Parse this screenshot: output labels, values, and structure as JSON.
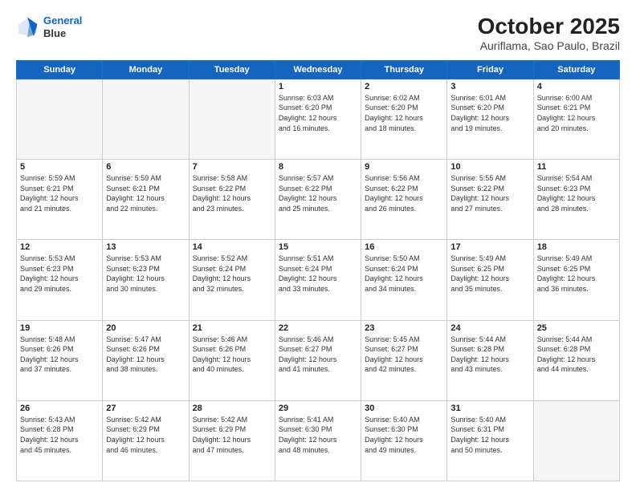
{
  "header": {
    "logo_line1": "General",
    "logo_line2": "Blue",
    "title": "October 2025",
    "subtitle": "Auriflama, Sao Paulo, Brazil"
  },
  "weekdays": [
    "Sunday",
    "Monday",
    "Tuesday",
    "Wednesday",
    "Thursday",
    "Friday",
    "Saturday"
  ],
  "weeks": [
    [
      {
        "day": "",
        "info": ""
      },
      {
        "day": "",
        "info": ""
      },
      {
        "day": "",
        "info": ""
      },
      {
        "day": "1",
        "info": "Sunrise: 6:03 AM\nSunset: 6:20 PM\nDaylight: 12 hours\nand 16 minutes."
      },
      {
        "day": "2",
        "info": "Sunrise: 6:02 AM\nSunset: 6:20 PM\nDaylight: 12 hours\nand 18 minutes."
      },
      {
        "day": "3",
        "info": "Sunrise: 6:01 AM\nSunset: 6:20 PM\nDaylight: 12 hours\nand 19 minutes."
      },
      {
        "day": "4",
        "info": "Sunrise: 6:00 AM\nSunset: 6:21 PM\nDaylight: 12 hours\nand 20 minutes."
      }
    ],
    [
      {
        "day": "5",
        "info": "Sunrise: 5:59 AM\nSunset: 6:21 PM\nDaylight: 12 hours\nand 21 minutes."
      },
      {
        "day": "6",
        "info": "Sunrise: 5:59 AM\nSunset: 6:21 PM\nDaylight: 12 hours\nand 22 minutes."
      },
      {
        "day": "7",
        "info": "Sunrise: 5:58 AM\nSunset: 6:22 PM\nDaylight: 12 hours\nand 23 minutes."
      },
      {
        "day": "8",
        "info": "Sunrise: 5:57 AM\nSunset: 6:22 PM\nDaylight: 12 hours\nand 25 minutes."
      },
      {
        "day": "9",
        "info": "Sunrise: 5:56 AM\nSunset: 6:22 PM\nDaylight: 12 hours\nand 26 minutes."
      },
      {
        "day": "10",
        "info": "Sunrise: 5:55 AM\nSunset: 6:22 PM\nDaylight: 12 hours\nand 27 minutes."
      },
      {
        "day": "11",
        "info": "Sunrise: 5:54 AM\nSunset: 6:23 PM\nDaylight: 12 hours\nand 28 minutes."
      }
    ],
    [
      {
        "day": "12",
        "info": "Sunrise: 5:53 AM\nSunset: 6:23 PM\nDaylight: 12 hours\nand 29 minutes."
      },
      {
        "day": "13",
        "info": "Sunrise: 5:53 AM\nSunset: 6:23 PM\nDaylight: 12 hours\nand 30 minutes."
      },
      {
        "day": "14",
        "info": "Sunrise: 5:52 AM\nSunset: 6:24 PM\nDaylight: 12 hours\nand 32 minutes."
      },
      {
        "day": "15",
        "info": "Sunrise: 5:51 AM\nSunset: 6:24 PM\nDaylight: 12 hours\nand 33 minutes."
      },
      {
        "day": "16",
        "info": "Sunrise: 5:50 AM\nSunset: 6:24 PM\nDaylight: 12 hours\nand 34 minutes."
      },
      {
        "day": "17",
        "info": "Sunrise: 5:49 AM\nSunset: 6:25 PM\nDaylight: 12 hours\nand 35 minutes."
      },
      {
        "day": "18",
        "info": "Sunrise: 5:49 AM\nSunset: 6:25 PM\nDaylight: 12 hours\nand 36 minutes."
      }
    ],
    [
      {
        "day": "19",
        "info": "Sunrise: 5:48 AM\nSunset: 6:26 PM\nDaylight: 12 hours\nand 37 minutes."
      },
      {
        "day": "20",
        "info": "Sunrise: 5:47 AM\nSunset: 6:26 PM\nDaylight: 12 hours\nand 38 minutes."
      },
      {
        "day": "21",
        "info": "Sunrise: 5:46 AM\nSunset: 6:26 PM\nDaylight: 12 hours\nand 40 minutes."
      },
      {
        "day": "22",
        "info": "Sunrise: 5:46 AM\nSunset: 6:27 PM\nDaylight: 12 hours\nand 41 minutes."
      },
      {
        "day": "23",
        "info": "Sunrise: 5:45 AM\nSunset: 6:27 PM\nDaylight: 12 hours\nand 42 minutes."
      },
      {
        "day": "24",
        "info": "Sunrise: 5:44 AM\nSunset: 6:28 PM\nDaylight: 12 hours\nand 43 minutes."
      },
      {
        "day": "25",
        "info": "Sunrise: 5:44 AM\nSunset: 6:28 PM\nDaylight: 12 hours\nand 44 minutes."
      }
    ],
    [
      {
        "day": "26",
        "info": "Sunrise: 5:43 AM\nSunset: 6:28 PM\nDaylight: 12 hours\nand 45 minutes."
      },
      {
        "day": "27",
        "info": "Sunrise: 5:42 AM\nSunset: 6:29 PM\nDaylight: 12 hours\nand 46 minutes."
      },
      {
        "day": "28",
        "info": "Sunrise: 5:42 AM\nSunset: 6:29 PM\nDaylight: 12 hours\nand 47 minutes."
      },
      {
        "day": "29",
        "info": "Sunrise: 5:41 AM\nSunset: 6:30 PM\nDaylight: 12 hours\nand 48 minutes."
      },
      {
        "day": "30",
        "info": "Sunrise: 5:40 AM\nSunset: 6:30 PM\nDaylight: 12 hours\nand 49 minutes."
      },
      {
        "day": "31",
        "info": "Sunrise: 5:40 AM\nSunset: 6:31 PM\nDaylight: 12 hours\nand 50 minutes."
      },
      {
        "day": "",
        "info": ""
      }
    ]
  ]
}
